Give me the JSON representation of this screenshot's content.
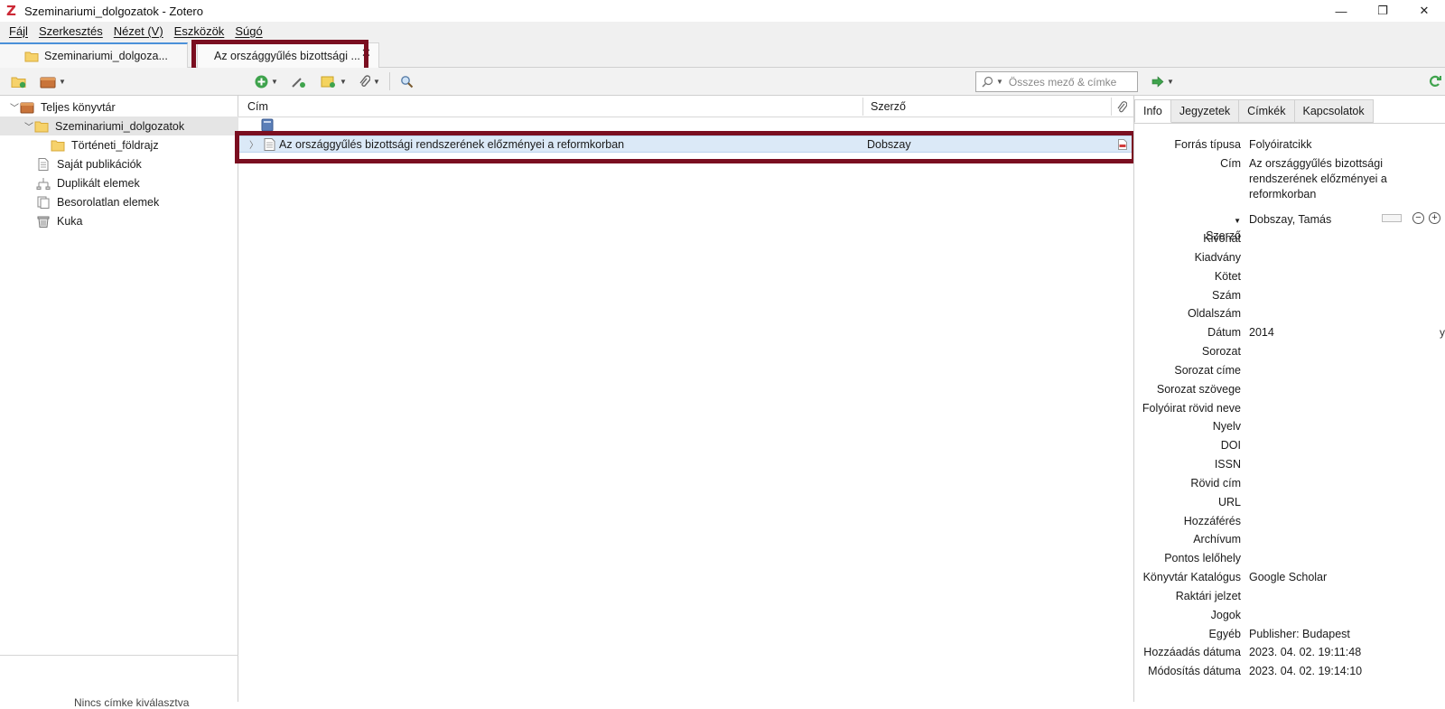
{
  "window": {
    "title": "Szeminariumi_dolgozatok - Zotero",
    "controls": {
      "minimize": "—",
      "restore": "❐",
      "close": "✕"
    }
  },
  "menu": [
    "Fájl",
    "Szerkesztés",
    "Nézet (V)",
    "Eszközök",
    "Súgó"
  ],
  "tabs": {
    "library": "Szeminariumi_dolgoza...",
    "item": "Az országgyűlés bizottsági ...",
    "close": "✕"
  },
  "toolbar": {
    "search_placeholder": "Összes mező & címke"
  },
  "collections": [
    {
      "label": "Teljes könyvtár",
      "icon": "library-icon"
    },
    {
      "label": "Szeminariumi_dolgozatok",
      "icon": "folder-icon"
    },
    {
      "label": "Történeti_földrajz",
      "icon": "folder-icon"
    },
    {
      "label": "Saját publikációk",
      "icon": "document-icon"
    },
    {
      "label": "Duplikált elemek",
      "icon": "duplicate-icon"
    },
    {
      "label": "Besorolatlan elemek",
      "icon": "unfiled-icon"
    },
    {
      "label": "Kuka",
      "icon": "trash-icon"
    }
  ],
  "left_bottom_text": "Nincs címke kiválasztva",
  "items_table": {
    "columns": [
      "Cím",
      "Szerző"
    ],
    "rows": [
      {
        "title": "Az országgyűlés bizottsági rendszerének előzményei a reformkorban",
        "author": "Dobszay"
      }
    ]
  },
  "item_pane": {
    "tabs": [
      "Info",
      "Jegyzetek",
      "Címkék",
      "Kapcsolatok"
    ],
    "fields": [
      {
        "label": "Forrás típusa",
        "value": "Folyóiratcikk"
      },
      {
        "label": "Cím",
        "value": "Az országgyűlés bizottsági rendszerének előzményei a reformkorban"
      },
      {
        "label": "Szerző",
        "value": "Dobszay, Tamás"
      },
      {
        "label": "Kivonat",
        "value": ""
      },
      {
        "label": "Kiadvány",
        "value": ""
      },
      {
        "label": "Kötet",
        "value": ""
      },
      {
        "label": "Szám",
        "value": ""
      },
      {
        "label": "Oldalszám",
        "value": ""
      },
      {
        "label": "Dátum",
        "value": "2014"
      },
      {
        "label": "Sorozat",
        "value": ""
      },
      {
        "label": "Sorozat címe",
        "value": ""
      },
      {
        "label": "Sorozat szövege",
        "value": ""
      },
      {
        "label": "Folyóirat rövid neve",
        "value": ""
      },
      {
        "label": "Nyelv",
        "value": ""
      },
      {
        "label": "DOI",
        "value": ""
      },
      {
        "label": "ISSN",
        "value": ""
      },
      {
        "label": "Rövid cím",
        "value": ""
      },
      {
        "label": "URL",
        "value": ""
      },
      {
        "label": "Hozzáférés",
        "value": ""
      },
      {
        "label": "Archívum",
        "value": ""
      },
      {
        "label": "Pontos lelőhely",
        "value": ""
      },
      {
        "label": "Könyvtár Katalógus",
        "value": "Google Scholar"
      },
      {
        "label": "Raktári jelzet",
        "value": ""
      },
      {
        "label": "Jogok",
        "value": ""
      },
      {
        "label": "Egyéb",
        "value": "Publisher: Budapest"
      },
      {
        "label": "Hozzáadás dátuma",
        "value": "2023. 04. 02. 19:11:48"
      },
      {
        "label": "Módosítás dátuma",
        "value": "2023. 04. 02. 19:14:10"
      }
    ],
    "date_marker": "y",
    "creator_minus": "−",
    "creator_plus": "+"
  },
  "colors": {
    "highlight_frame": "#7a0e20",
    "selected_row": "#dbe9f7",
    "zotero_red": "#cc2936"
  }
}
